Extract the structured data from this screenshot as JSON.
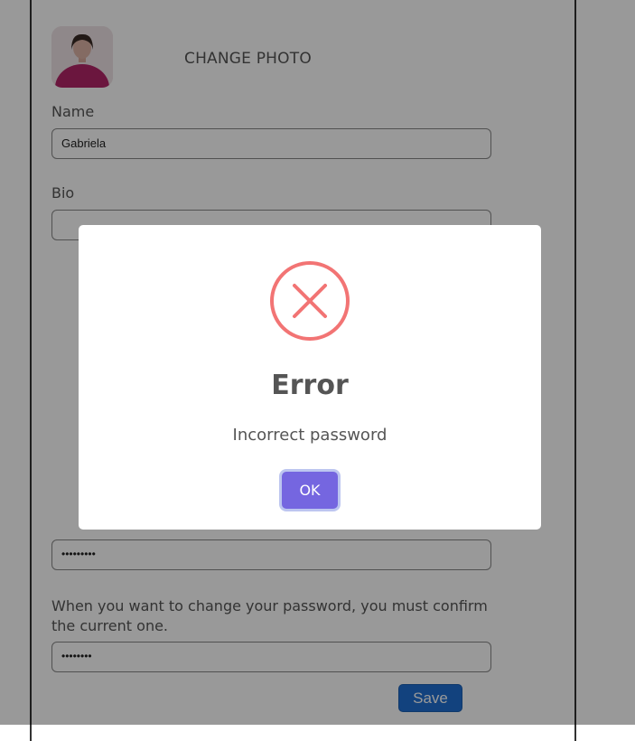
{
  "profile": {
    "change_photo_label": "CHANGE PHOTO",
    "name_label": "Name",
    "name_value": "Gabriela",
    "bio_label": "Bio",
    "password_value": "•••••••••",
    "password_note": "When you want to change your password, you must confirm the current one.",
    "current_password_value": "••••••••",
    "save_label": "Save"
  },
  "dialog": {
    "icon": "error-x-icon",
    "title": "Error",
    "message": "Incorrect password",
    "ok_label": "OK"
  },
  "colors": {
    "error_icon": "#f27474",
    "ok_button": "#7566e0",
    "save_button": "#1f6fd3"
  }
}
